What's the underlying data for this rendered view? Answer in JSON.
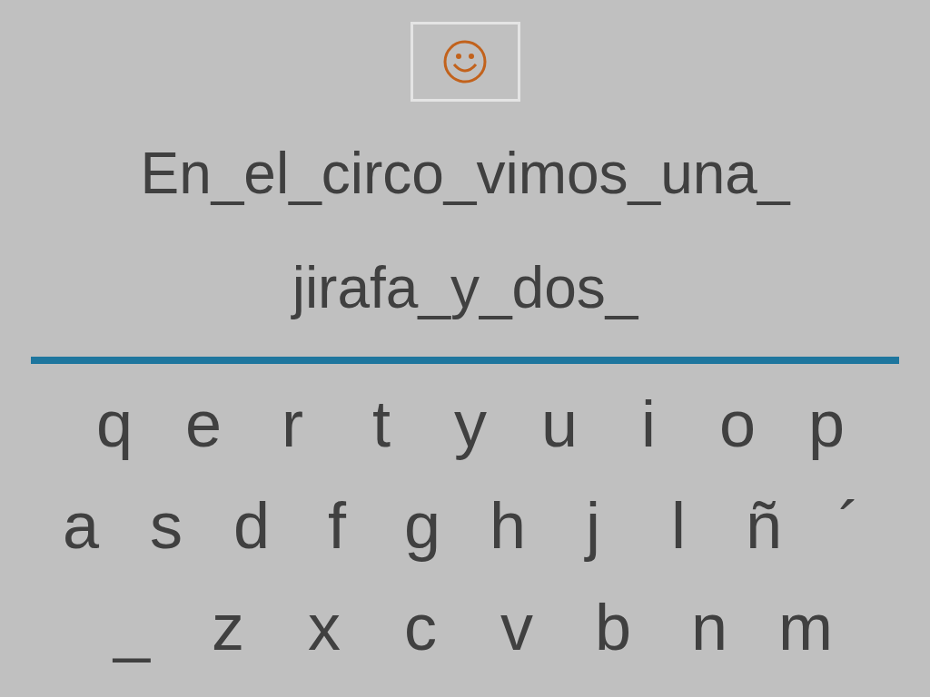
{
  "sentence": {
    "lines": [
      "En_el_circo_vimos_una_",
      "jirafa_y_dos_"
    ]
  },
  "keyboard": {
    "rows": [
      [
        "q",
        "e",
        "r",
        "t",
        "y",
        "u",
        "i",
        "o",
        "p"
      ],
      [
        "a",
        "s",
        "d",
        "f",
        "g",
        "h",
        "j",
        "l",
        "ñ",
        "´"
      ],
      [
        "_",
        "z",
        "x",
        "c",
        "v",
        "b",
        "n",
        "m"
      ]
    ]
  }
}
